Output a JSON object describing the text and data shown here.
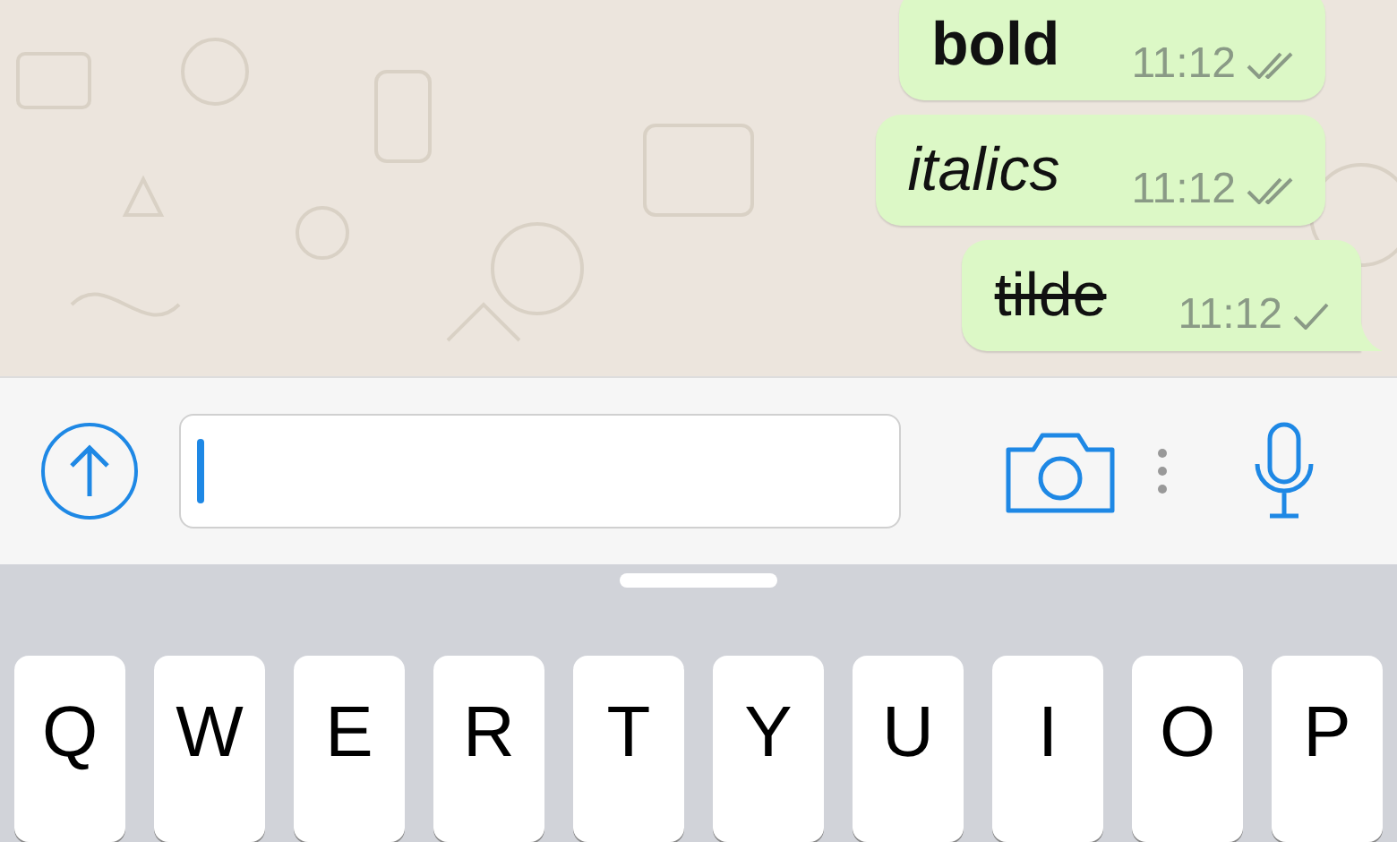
{
  "messages": [
    {
      "text": "bold",
      "kind": "bold",
      "time": "11:12",
      "read": true,
      "tail": false
    },
    {
      "text": "italics",
      "kind": "italic",
      "time": "11:12",
      "read": true,
      "tail": false
    },
    {
      "text": "tilde",
      "kind": "strike",
      "time": "11:12",
      "read": false,
      "tail": true
    }
  ],
  "keyboard": {
    "keys": [
      "Q",
      "W",
      "E",
      "R",
      "T",
      "Y",
      "U",
      "I",
      "O",
      "P"
    ]
  }
}
